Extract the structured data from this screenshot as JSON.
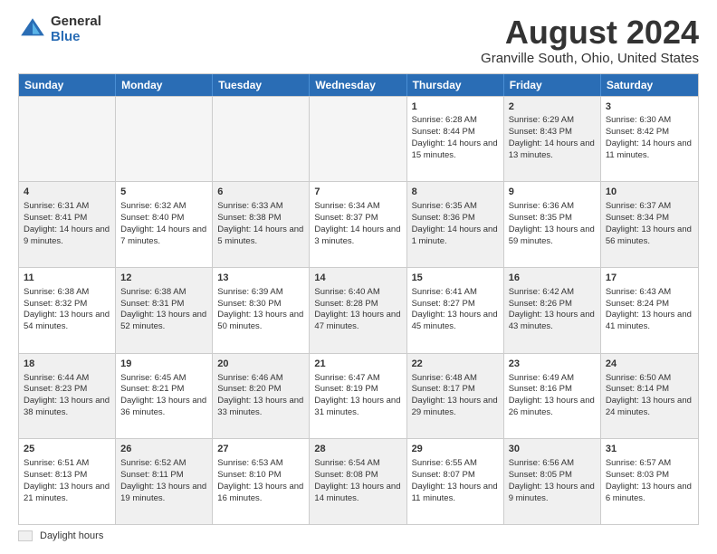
{
  "logo": {
    "general": "General",
    "blue": "Blue"
  },
  "title": "August 2024",
  "location": "Granville South, Ohio, United States",
  "weekdays": [
    "Sunday",
    "Monday",
    "Tuesday",
    "Wednesday",
    "Thursday",
    "Friday",
    "Saturday"
  ],
  "legend": {
    "box_label": "Daylight hours"
  },
  "rows": [
    [
      {
        "day": "",
        "empty": true
      },
      {
        "day": "",
        "empty": true
      },
      {
        "day": "",
        "empty": true
      },
      {
        "day": "",
        "empty": true
      },
      {
        "day": "1",
        "sunrise": "Sunrise: 6:28 AM",
        "sunset": "Sunset: 8:44 PM",
        "daylight": "Daylight: 14 hours and 15 minutes."
      },
      {
        "day": "2",
        "sunrise": "Sunrise: 6:29 AM",
        "sunset": "Sunset: 8:43 PM",
        "daylight": "Daylight: 14 hours and 13 minutes.",
        "shaded": true
      },
      {
        "day": "3",
        "sunrise": "Sunrise: 6:30 AM",
        "sunset": "Sunset: 8:42 PM",
        "daylight": "Daylight: 14 hours and 11 minutes."
      }
    ],
    [
      {
        "day": "4",
        "sunrise": "Sunrise: 6:31 AM",
        "sunset": "Sunset: 8:41 PM",
        "daylight": "Daylight: 14 hours and 9 minutes.",
        "shaded": true
      },
      {
        "day": "5",
        "sunrise": "Sunrise: 6:32 AM",
        "sunset": "Sunset: 8:40 PM",
        "daylight": "Daylight: 14 hours and 7 minutes."
      },
      {
        "day": "6",
        "sunrise": "Sunrise: 6:33 AM",
        "sunset": "Sunset: 8:38 PM",
        "daylight": "Daylight: 14 hours and 5 minutes.",
        "shaded": true
      },
      {
        "day": "7",
        "sunrise": "Sunrise: 6:34 AM",
        "sunset": "Sunset: 8:37 PM",
        "daylight": "Daylight: 14 hours and 3 minutes."
      },
      {
        "day": "8",
        "sunrise": "Sunrise: 6:35 AM",
        "sunset": "Sunset: 8:36 PM",
        "daylight": "Daylight: 14 hours and 1 minute.",
        "shaded": true
      },
      {
        "day": "9",
        "sunrise": "Sunrise: 6:36 AM",
        "sunset": "Sunset: 8:35 PM",
        "daylight": "Daylight: 13 hours and 59 minutes."
      },
      {
        "day": "10",
        "sunrise": "Sunrise: 6:37 AM",
        "sunset": "Sunset: 8:34 PM",
        "daylight": "Daylight: 13 hours and 56 minutes.",
        "shaded": true
      }
    ],
    [
      {
        "day": "11",
        "sunrise": "Sunrise: 6:38 AM",
        "sunset": "Sunset: 8:32 PM",
        "daylight": "Daylight: 13 hours and 54 minutes."
      },
      {
        "day": "12",
        "sunrise": "Sunrise: 6:38 AM",
        "sunset": "Sunset: 8:31 PM",
        "daylight": "Daylight: 13 hours and 52 minutes.",
        "shaded": true
      },
      {
        "day": "13",
        "sunrise": "Sunrise: 6:39 AM",
        "sunset": "Sunset: 8:30 PM",
        "daylight": "Daylight: 13 hours and 50 minutes."
      },
      {
        "day": "14",
        "sunrise": "Sunrise: 6:40 AM",
        "sunset": "Sunset: 8:28 PM",
        "daylight": "Daylight: 13 hours and 47 minutes.",
        "shaded": true
      },
      {
        "day": "15",
        "sunrise": "Sunrise: 6:41 AM",
        "sunset": "Sunset: 8:27 PM",
        "daylight": "Daylight: 13 hours and 45 minutes."
      },
      {
        "day": "16",
        "sunrise": "Sunrise: 6:42 AM",
        "sunset": "Sunset: 8:26 PM",
        "daylight": "Daylight: 13 hours and 43 minutes.",
        "shaded": true
      },
      {
        "day": "17",
        "sunrise": "Sunrise: 6:43 AM",
        "sunset": "Sunset: 8:24 PM",
        "daylight": "Daylight: 13 hours and 41 minutes."
      }
    ],
    [
      {
        "day": "18",
        "sunrise": "Sunrise: 6:44 AM",
        "sunset": "Sunset: 8:23 PM",
        "daylight": "Daylight: 13 hours and 38 minutes.",
        "shaded": true
      },
      {
        "day": "19",
        "sunrise": "Sunrise: 6:45 AM",
        "sunset": "Sunset: 8:21 PM",
        "daylight": "Daylight: 13 hours and 36 minutes."
      },
      {
        "day": "20",
        "sunrise": "Sunrise: 6:46 AM",
        "sunset": "Sunset: 8:20 PM",
        "daylight": "Daylight: 13 hours and 33 minutes.",
        "shaded": true
      },
      {
        "day": "21",
        "sunrise": "Sunrise: 6:47 AM",
        "sunset": "Sunset: 8:19 PM",
        "daylight": "Daylight: 13 hours and 31 minutes."
      },
      {
        "day": "22",
        "sunrise": "Sunrise: 6:48 AM",
        "sunset": "Sunset: 8:17 PM",
        "daylight": "Daylight: 13 hours and 29 minutes.",
        "shaded": true
      },
      {
        "day": "23",
        "sunrise": "Sunrise: 6:49 AM",
        "sunset": "Sunset: 8:16 PM",
        "daylight": "Daylight: 13 hours and 26 minutes."
      },
      {
        "day": "24",
        "sunrise": "Sunrise: 6:50 AM",
        "sunset": "Sunset: 8:14 PM",
        "daylight": "Daylight: 13 hours and 24 minutes.",
        "shaded": true
      }
    ],
    [
      {
        "day": "25",
        "sunrise": "Sunrise: 6:51 AM",
        "sunset": "Sunset: 8:13 PM",
        "daylight": "Daylight: 13 hours and 21 minutes."
      },
      {
        "day": "26",
        "sunrise": "Sunrise: 6:52 AM",
        "sunset": "Sunset: 8:11 PM",
        "daylight": "Daylight: 13 hours and 19 minutes.",
        "shaded": true
      },
      {
        "day": "27",
        "sunrise": "Sunrise: 6:53 AM",
        "sunset": "Sunset: 8:10 PM",
        "daylight": "Daylight: 13 hours and 16 minutes."
      },
      {
        "day": "28",
        "sunrise": "Sunrise: 6:54 AM",
        "sunset": "Sunset: 8:08 PM",
        "daylight": "Daylight: 13 hours and 14 minutes.",
        "shaded": true
      },
      {
        "day": "29",
        "sunrise": "Sunrise: 6:55 AM",
        "sunset": "Sunset: 8:07 PM",
        "daylight": "Daylight: 13 hours and 11 minutes."
      },
      {
        "day": "30",
        "sunrise": "Sunrise: 6:56 AM",
        "sunset": "Sunset: 8:05 PM",
        "daylight": "Daylight: 13 hours and 9 minutes.",
        "shaded": true
      },
      {
        "day": "31",
        "sunrise": "Sunrise: 6:57 AM",
        "sunset": "Sunset: 8:03 PM",
        "daylight": "Daylight: 13 hours and 6 minutes."
      }
    ]
  ]
}
